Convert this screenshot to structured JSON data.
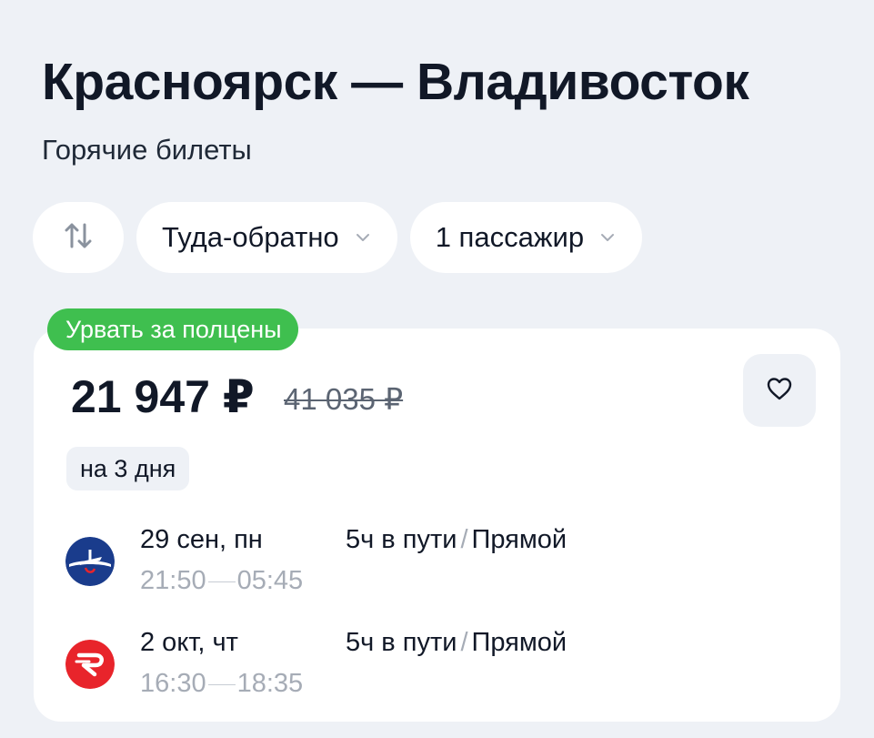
{
  "header": {
    "title": "Красноярск — Владивосток",
    "subtitle": "Горячие билеты"
  },
  "filters": {
    "swap_icon": "swap-vertical-icon",
    "trip_type": "Туда-обратно",
    "passengers": "1 пассажир"
  },
  "offer": {
    "badge": "Урвать за полцены",
    "price": "21 947 ₽",
    "old_price": "41 035 ₽",
    "duration": "на 3 дня",
    "badge_color": "#3fbf4f",
    "flights": [
      {
        "airline_icon": "aeroflot-logo",
        "date": "29 сен, пн",
        "depart": "21:50",
        "arrive": "05:45",
        "travel_time": "5ч в пути",
        "stops": "Прямой"
      },
      {
        "airline_icon": "nordwind-logo",
        "date": "2 окт, чт",
        "depart": "16:30",
        "arrive": "18:35",
        "travel_time": "5ч в пути",
        "stops": "Прямой"
      }
    ]
  }
}
